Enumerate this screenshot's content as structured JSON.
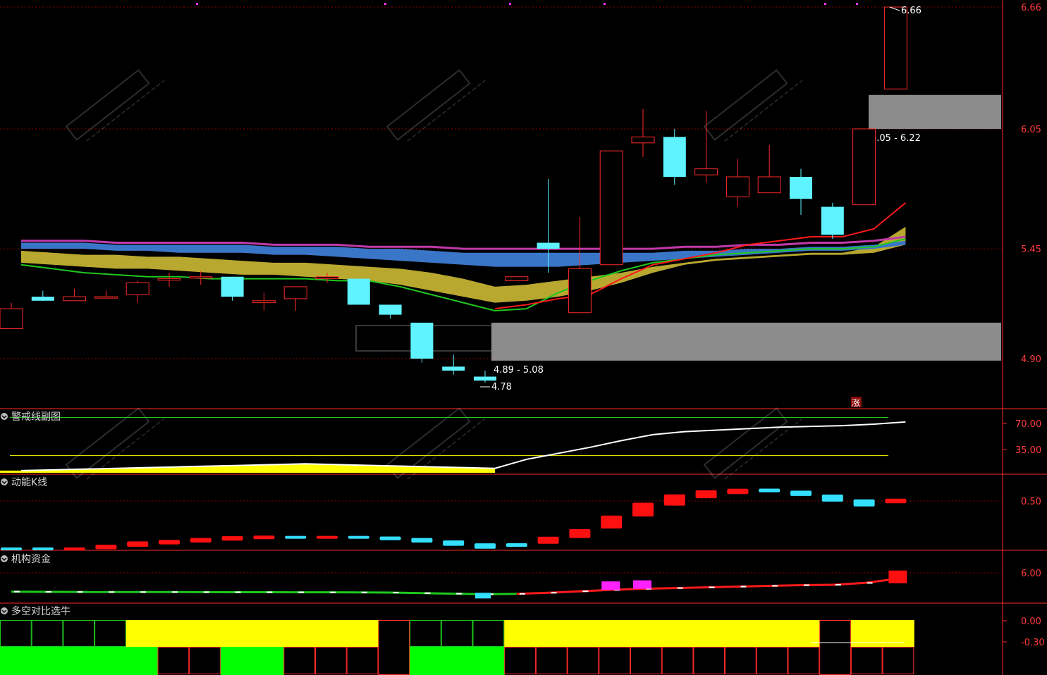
{
  "colors": {
    "background": "#000000",
    "grid": "#8b0000",
    "axis_text": "#ff3b3b",
    "up_candle": "#ff2a2a",
    "down_candle": "#5ef3ff",
    "ma_yellow": "#b8a830",
    "ma_blue": "#3a76c8",
    "ma_pink": "#c03aa8",
    "line_green": "#1ec81e",
    "line_red": "#ff1a1a",
    "zone_gray": "#8c8c8c",
    "yellow": "#ffff00",
    "green_fill": "#00ff00"
  },
  "chart_data": [
    {
      "type": "candlestick",
      "panel": "main",
      "yticks": [
        4.9,
        5.45,
        6.05,
        6.66
      ],
      "ylim": [
        4.55,
        6.7
      ],
      "candles": [
        {
          "o": 5.05,
          "c": 5.15,
          "h": 5.18,
          "l": 5.05
        },
        {
          "o": 5.21,
          "c": 5.19,
          "h": 5.24,
          "l": 5.19
        },
        {
          "o": 5.19,
          "c": 5.21,
          "h": 5.25,
          "l": 5.19
        },
        {
          "o": 5.21,
          "c": 5.21,
          "h": 5.24,
          "l": 5.21
        },
        {
          "o": 5.22,
          "c": 5.28,
          "h": 5.29,
          "l": 5.18
        },
        {
          "o": 5.3,
          "c": 5.3,
          "h": 5.33,
          "l": 5.26
        },
        {
          "o": 5.31,
          "c": 5.31,
          "h": 5.34,
          "l": 5.27
        },
        {
          "o": 5.31,
          "c": 5.21,
          "h": 5.31,
          "l": 5.19
        },
        {
          "o": 5.18,
          "c": 5.19,
          "h": 5.23,
          "l": 5.14
        },
        {
          "o": 5.2,
          "c": 5.26,
          "h": 5.26,
          "l": 5.14
        },
        {
          "o": 5.3,
          "c": 5.31,
          "h": 5.33,
          "l": 5.28
        },
        {
          "o": 5.3,
          "c": 5.17,
          "h": 5.3,
          "l": 5.17
        },
        {
          "o": 5.17,
          "c": 5.12,
          "h": 5.17,
          "l": 5.1
        },
        {
          "o": 5.08,
          "c": 4.9,
          "h": 5.08,
          "l": 4.88
        },
        {
          "o": 4.86,
          "c": 4.84,
          "h": 4.92,
          "l": 4.82
        },
        {
          "o": 4.81,
          "c": 4.79,
          "h": 4.84,
          "l": 4.78
        },
        {
          "o": 5.29,
          "c": 5.31,
          "h": 5.31,
          "l": 5.29
        },
        {
          "o": 5.48,
          "c": 5.45,
          "h": 5.8,
          "l": 5.33
        },
        {
          "o": 5.13,
          "c": 5.35,
          "h": 5.61,
          "l": 5.13
        },
        {
          "o": 5.37,
          "c": 5.94,
          "h": 5.94,
          "l": 5.37
        },
        {
          "o": 5.98,
          "c": 6.01,
          "h": 6.15,
          "l": 5.91
        },
        {
          "o": 6.01,
          "c": 5.81,
          "h": 6.05,
          "l": 5.77
        },
        {
          "o": 5.82,
          "c": 5.85,
          "h": 6.14,
          "l": 5.78
        },
        {
          "o": 5.71,
          "c": 5.81,
          "h": 5.9,
          "l": 5.66
        },
        {
          "o": 5.73,
          "c": 5.81,
          "h": 5.97,
          "l": 5.73
        },
        {
          "o": 5.81,
          "c": 5.7,
          "h": 5.85,
          "l": 5.62
        },
        {
          "o": 5.66,
          "c": 5.52,
          "h": 5.68,
          "l": 5.5
        },
        {
          "o": 5.67,
          "c": 6.05,
          "h": 6.05,
          "l": 5.67
        },
        {
          "o": 6.25,
          "c": 6.66,
          "h": 6.66,
          "l": 6.25
        }
      ],
      "zones": [
        {
          "label": "4.89 - 5.08",
          "low": 4.89,
          "high": 5.08
        },
        {
          "label": "6.05 - 6.22",
          "low": 6.05,
          "high": 6.22
        }
      ],
      "markers": {
        "high_label": "6.66",
        "low_label": "4.78",
        "rise_label": "涨"
      },
      "ma_yellow_top": [
        5.44,
        5.43,
        5.42,
        5.42,
        5.41,
        5.41,
        5.4,
        5.39,
        5.38,
        5.38,
        5.37,
        5.36,
        5.35,
        5.33,
        5.3,
        5.26,
        5.27,
        5.29,
        5.31,
        5.33,
        5.36,
        5.38,
        5.4,
        5.41,
        5.42,
        5.43,
        5.43,
        5.46,
        5.56
      ],
      "ma_yellow_bot": [
        5.38,
        5.37,
        5.36,
        5.35,
        5.35,
        5.34,
        5.33,
        5.32,
        5.32,
        5.31,
        5.3,
        5.29,
        5.27,
        5.24,
        5.21,
        5.18,
        5.19,
        5.21,
        5.24,
        5.28,
        5.33,
        5.37,
        5.39,
        5.4,
        5.41,
        5.42,
        5.42,
        5.43,
        5.47
      ],
      "ma_blue_top": [
        5.48,
        5.48,
        5.48,
        5.47,
        5.47,
        5.47,
        5.47,
        5.47,
        5.46,
        5.46,
        5.46,
        5.45,
        5.45,
        5.44,
        5.43,
        5.43,
        5.43,
        5.43,
        5.43,
        5.43,
        5.43,
        5.44,
        5.44,
        5.45,
        5.45,
        5.46,
        5.46,
        5.47,
        5.49
      ],
      "ma_blue_bot": [
        5.45,
        5.45,
        5.45,
        5.44,
        5.44,
        5.43,
        5.43,
        5.43,
        5.42,
        5.42,
        5.41,
        5.4,
        5.39,
        5.38,
        5.37,
        5.36,
        5.36,
        5.36,
        5.37,
        5.38,
        5.39,
        5.4,
        5.41,
        5.42,
        5.43,
        5.44,
        5.44,
        5.45,
        5.47
      ],
      "ma_pink": [
        5.49,
        5.49,
        5.49,
        5.48,
        5.48,
        5.48,
        5.48,
        5.48,
        5.47,
        5.47,
        5.47,
        5.46,
        5.46,
        5.46,
        5.45,
        5.45,
        5.45,
        5.45,
        5.45,
        5.45,
        5.45,
        5.46,
        5.46,
        5.47,
        5.47,
        5.48,
        5.48,
        5.49,
        5.51
      ],
      "line_green": [
        5.37,
        5.35,
        5.33,
        5.32,
        5.31,
        5.31,
        5.3,
        5.3,
        5.3,
        5.3,
        5.29,
        5.29,
        5.26,
        5.22,
        5.18,
        5.14,
        5.15,
        5.23,
        5.29,
        5.34,
        5.38,
        5.4,
        5.42,
        5.43,
        5.44,
        5.45,
        5.45,
        5.46,
        5.5
      ],
      "line_red": [
        null,
        null,
        null,
        null,
        null,
        null,
        null,
        null,
        null,
        null,
        null,
        null,
        null,
        null,
        null,
        5.15,
        5.17,
        5.2,
        5.22,
        5.3,
        5.37,
        5.4,
        5.43,
        5.47,
        5.49,
        5.51,
        5.51,
        5.55,
        5.68
      ]
    },
    {
      "type": "line",
      "panel": "警戒线副图",
      "title": "警戒线副图",
      "yticks": [
        35.0,
        70.0
      ],
      "ylim": [
        5,
        85
      ],
      "white_line": [
        7,
        8,
        9,
        10,
        11,
        12,
        13,
        14,
        15,
        16,
        15,
        14,
        13,
        12,
        11,
        10,
        22,
        30,
        38,
        47,
        55,
        59,
        61,
        63,
        65,
        66,
        67,
        69,
        72
      ],
      "green_level": 78,
      "yellow_level": 27
    },
    {
      "type": "bar",
      "panel": "动能K线",
      "title": "动能K线",
      "yticks": [
        0.5
      ],
      "ylim": [
        0.0,
        0.7
      ],
      "values": [
        0.0,
        0.0,
        0.0,
        0.02,
        0.05,
        0.07,
        0.09,
        0.11,
        0.12,
        0.12,
        0.12,
        0.12,
        0.11,
        0.09,
        0.06,
        0.03,
        0.04,
        0.09,
        0.16,
        0.28,
        0.41,
        0.51,
        0.57,
        0.6,
        0.61,
        0.58,
        0.53,
        0.48,
        0.5
      ],
      "colors": [
        "cyan",
        "cyan",
        "red",
        "red",
        "red",
        "red",
        "red",
        "red",
        "red",
        "cyan",
        "red",
        "cyan",
        "cyan",
        "cyan",
        "cyan",
        "cyan",
        "cyan",
        "red",
        "red",
        "red",
        "red",
        "red",
        "red",
        "red",
        "cyan",
        "cyan",
        "cyan",
        "cyan",
        "red"
      ]
    },
    {
      "type": "line",
      "panel": "机构资金",
      "title": "机构资金",
      "yticks": [
        6.0
      ],
      "ylim": [
        -1.0,
        7.5
      ],
      "values": [
        0.8,
        0.75,
        0.72,
        0.7,
        0.7,
        0.7,
        0.68,
        0.66,
        0.65,
        0.64,
        0.62,
        0.6,
        0.55,
        0.4,
        0.25,
        0.1,
        0.2,
        0.5,
        0.9,
        1.3,
        1.6,
        1.8,
        2.0,
        2.2,
        2.4,
        2.6,
        2.7,
        3.2,
        4.3
      ],
      "magenta_bars": [
        19,
        20
      ]
    },
    {
      "type": "bar",
      "panel": "多空对比选牛",
      "title": "多空对比选牛",
      "yticks": [
        0.0,
        -0.3
      ],
      "top_row": [
        "g",
        "g",
        "g",
        "g",
        "y",
        "y",
        "y",
        "y",
        "y",
        "y",
        "y",
        "y",
        "k",
        "g",
        "g",
        "g",
        "y",
        "y",
        "y",
        "y",
        "y",
        "y",
        "y",
        "y",
        "y",
        "y",
        "k",
        "y",
        "y"
      ],
      "bottom_row": [
        "G",
        "G",
        "G",
        "G",
        "G",
        "r",
        "r",
        "G",
        "G",
        "r",
        "r",
        "r",
        "k",
        "G",
        "G",
        "G",
        "r",
        "r",
        "r",
        "r",
        "r",
        "r",
        "r",
        "r",
        "r",
        "r",
        "r",
        "r",
        "r"
      ]
    }
  ]
}
